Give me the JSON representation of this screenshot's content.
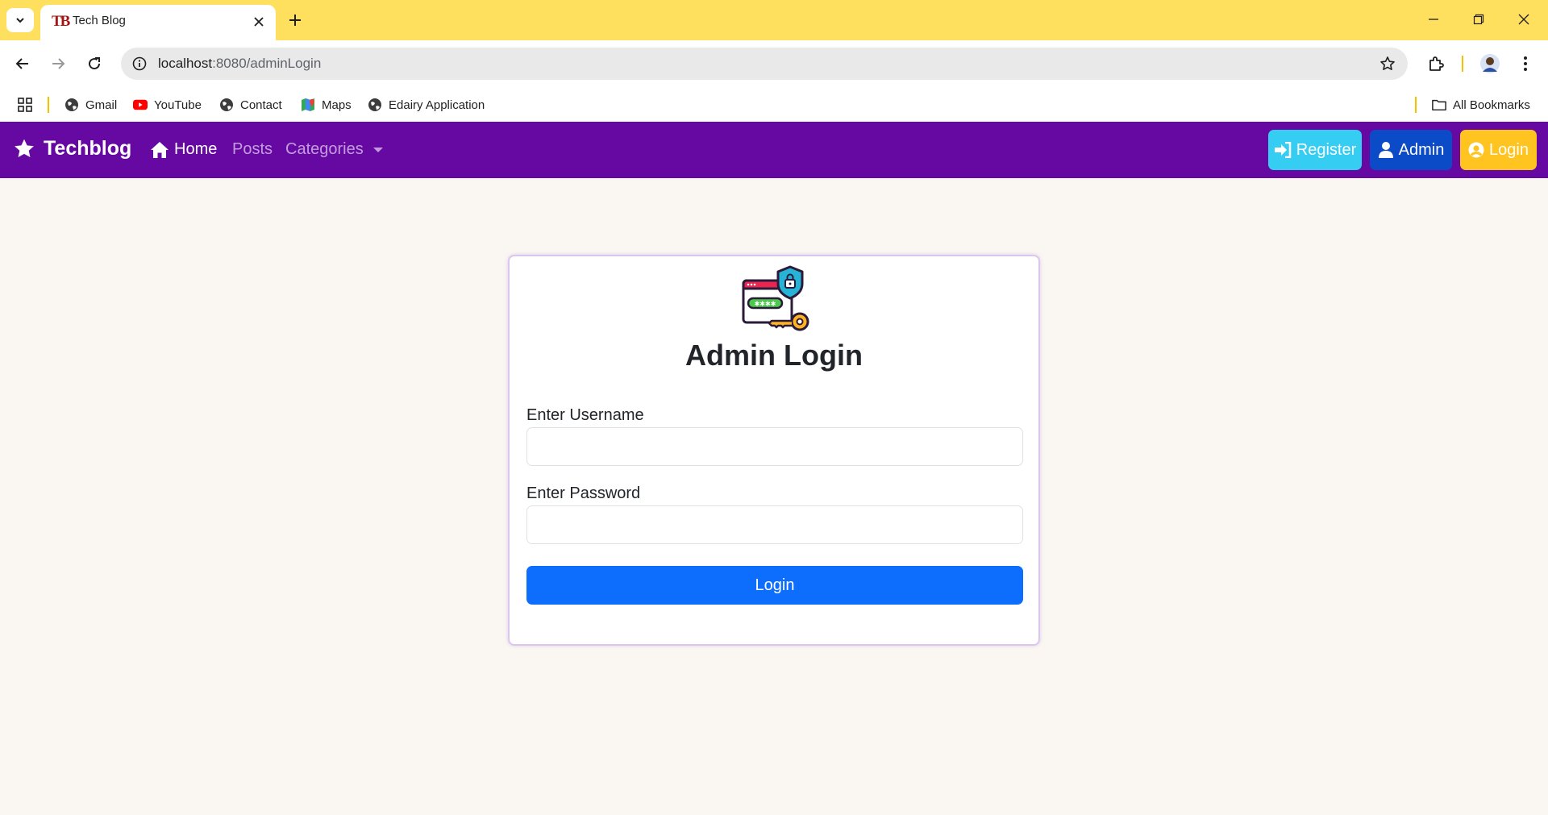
{
  "browser": {
    "tab": {
      "favicon_text": "TB",
      "title": "Tech Blog"
    },
    "address": {
      "host": "localhost",
      "path": ":8080/adminLogin"
    },
    "bookmarks": [
      {
        "label": "Gmail",
        "icon": "globe-icon"
      },
      {
        "label": "YouTube",
        "icon": "youtube-icon"
      },
      {
        "label": "Contact",
        "icon": "globe-icon"
      },
      {
        "label": "Maps",
        "icon": "maps-icon"
      },
      {
        "label": "Edairy Application",
        "icon": "globe-icon"
      }
    ],
    "all_bookmarks": "All Bookmarks",
    "colors": {
      "tabstrip": "#ffe05e",
      "omnibox": "#e9e9e9"
    }
  },
  "navbar": {
    "brand": "Techblog",
    "links": {
      "home": "Home",
      "posts": "Posts",
      "categories": "Categories"
    },
    "buttons": {
      "register": "Register",
      "admin": "Admin",
      "login": "Login"
    },
    "colors": {
      "bar": "#6609a3",
      "register": "#35cdf2",
      "admin": "#0b4bc7",
      "login": "#ffc41f"
    }
  },
  "login_card": {
    "title": "Admin Login",
    "username_label": "Enter Username",
    "username_value": "",
    "password_label": "Enter Password",
    "password_value": "",
    "submit_label": "Login",
    "colors": {
      "submit": "#0d6efd",
      "border": "#ddc6ee"
    }
  }
}
